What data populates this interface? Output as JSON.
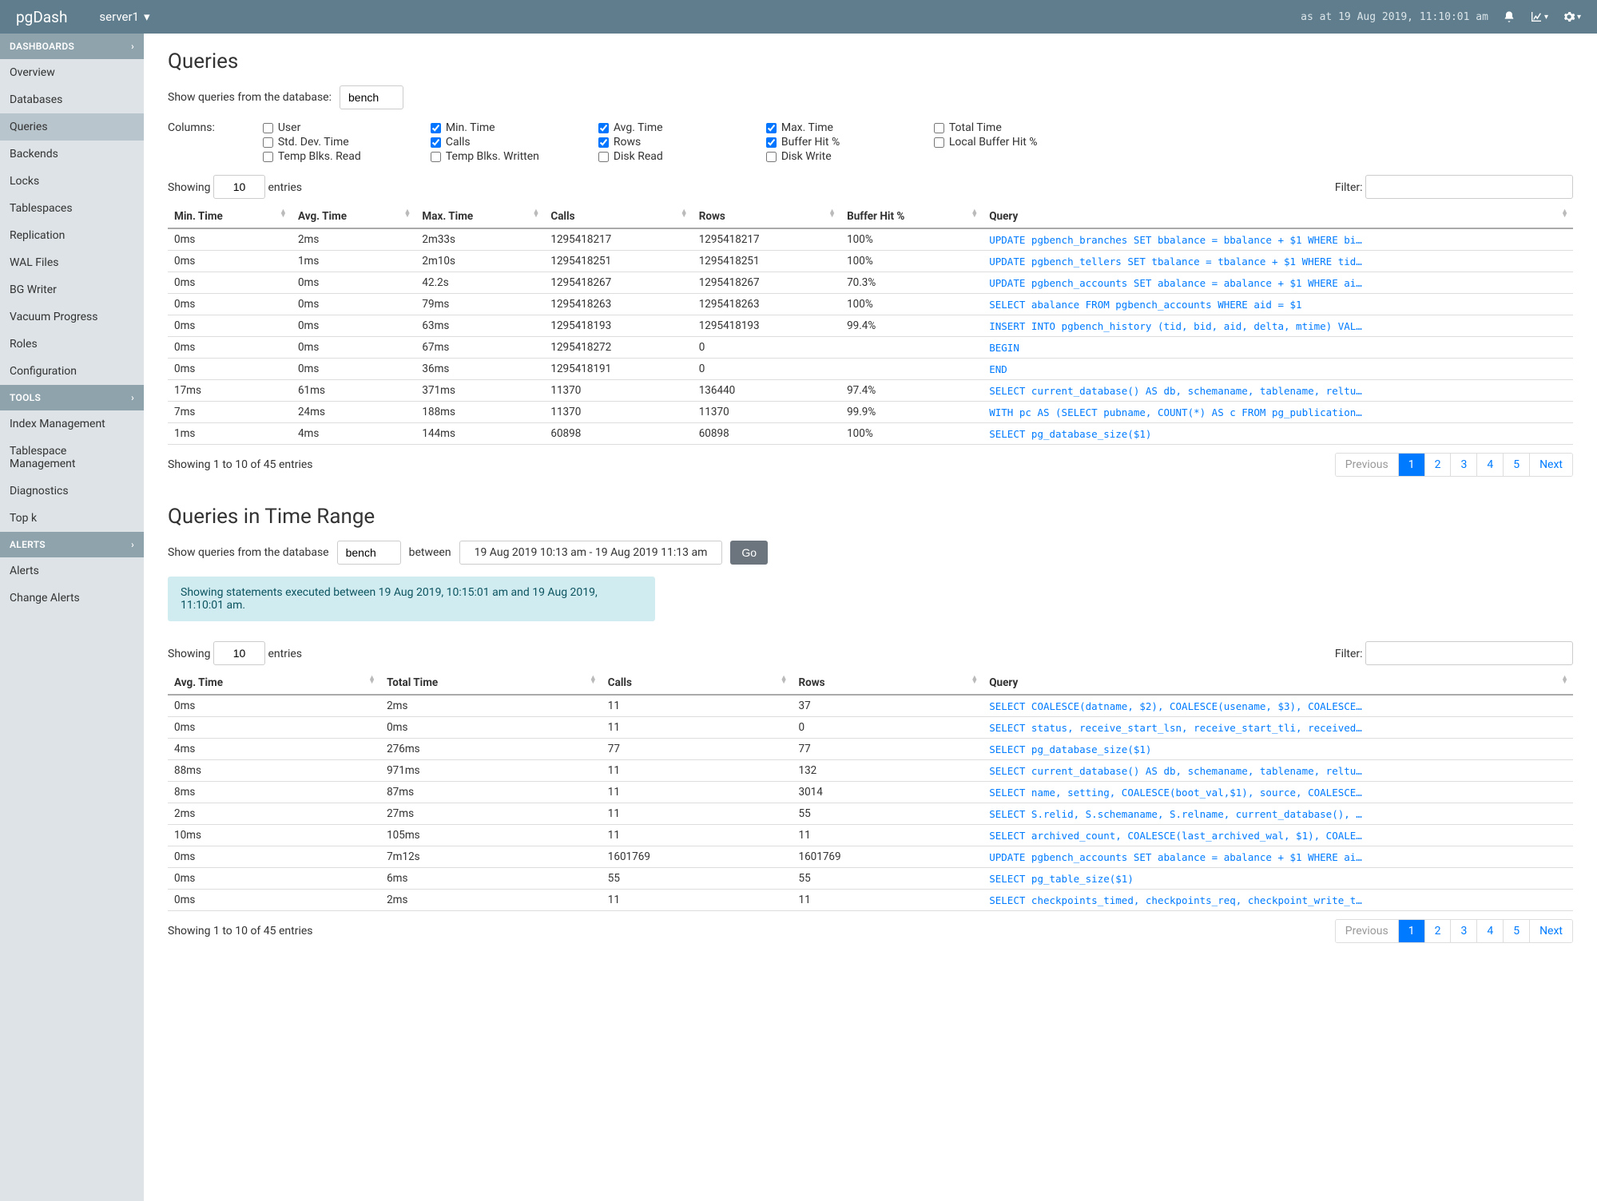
{
  "topbar": {
    "brand": "pgDash",
    "server": "server1",
    "timestamp": "as at 19 Aug 2019, 11:10:01 am"
  },
  "sidebar": {
    "sections": [
      {
        "title": "DASHBOARDS",
        "items": [
          "Overview",
          "Databases",
          "Queries",
          "Backends",
          "Locks",
          "Tablespaces",
          "Replication",
          "WAL Files",
          "BG Writer",
          "Vacuum Progress",
          "Roles",
          "Configuration"
        ],
        "active": "Queries"
      },
      {
        "title": "TOOLS",
        "items": [
          "Index Management",
          "Tablespace Management",
          "Diagnostics",
          "Top k"
        ]
      },
      {
        "title": "ALERTS",
        "items": [
          "Alerts",
          "Change Alerts"
        ]
      }
    ]
  },
  "queries": {
    "title": "Queries",
    "dbLabel": "Show queries from the database:",
    "dbValue": "bench",
    "columnsLabel": "Columns:",
    "columnOptions": [
      {
        "name": "User",
        "checked": false
      },
      {
        "name": "Min. Time",
        "checked": true
      },
      {
        "name": "Avg. Time",
        "checked": true
      },
      {
        "name": "Max. Time",
        "checked": true
      },
      {
        "name": "Total Time",
        "checked": false
      },
      {
        "name": "Std. Dev. Time",
        "checked": false
      },
      {
        "name": "Calls",
        "checked": true
      },
      {
        "name": "Rows",
        "checked": true
      },
      {
        "name": "Buffer Hit %",
        "checked": true
      },
      {
        "name": "Local Buffer Hit %",
        "checked": false
      },
      {
        "name": "Temp Blks. Read",
        "checked": false
      },
      {
        "name": "Temp Blks. Written",
        "checked": false
      },
      {
        "name": "Disk Read",
        "checked": false
      },
      {
        "name": "Disk Write",
        "checked": false
      }
    ],
    "showing_prefix": "Showing",
    "showing_entries": "entries",
    "showing_value": "10",
    "filter_label": "Filter:",
    "headers": [
      "Min. Time",
      "Avg. Time",
      "Max. Time",
      "Calls",
      "Rows",
      "Buffer Hit %",
      "Query"
    ],
    "rows": [
      {
        "min": "0ms",
        "avg": "2ms",
        "max": "2m33s",
        "calls": "1295418217",
        "rows": "1295418217",
        "hit": "100%",
        "query": "UPDATE pgbench_branches SET bbalance = bbalance + $1 WHERE bi…"
      },
      {
        "min": "0ms",
        "avg": "1ms",
        "max": "2m10s",
        "calls": "1295418251",
        "rows": "1295418251",
        "hit": "100%",
        "query": "UPDATE pgbench_tellers SET tbalance = tbalance + $1 WHERE tid…"
      },
      {
        "min": "0ms",
        "avg": "0ms",
        "max": "42.2s",
        "calls": "1295418267",
        "rows": "1295418267",
        "hit": "70.3%",
        "query": "UPDATE pgbench_accounts SET abalance = abalance + $1 WHERE ai…"
      },
      {
        "min": "0ms",
        "avg": "0ms",
        "max": "79ms",
        "calls": "1295418263",
        "rows": "1295418263",
        "hit": "100%",
        "query": "SELECT abalance FROM pgbench_accounts WHERE aid = $1"
      },
      {
        "min": "0ms",
        "avg": "0ms",
        "max": "63ms",
        "calls": "1295418193",
        "rows": "1295418193",
        "hit": "99.4%",
        "query": "INSERT INTO pgbench_history (tid, bid, aid, delta, mtime) VAL…"
      },
      {
        "min": "0ms",
        "avg": "0ms",
        "max": "67ms",
        "calls": "1295418272",
        "rows": "0",
        "hit": "",
        "query": "BEGIN"
      },
      {
        "min": "0ms",
        "avg": "0ms",
        "max": "36ms",
        "calls": "1295418191",
        "rows": "0",
        "hit": "",
        "query": "END"
      },
      {
        "min": "17ms",
        "avg": "61ms",
        "max": "371ms",
        "calls": "11370",
        "rows": "136440",
        "hit": "97.4%",
        "query": "SELECT current_database() AS db, schemaname, tablename, reltu…"
      },
      {
        "min": "7ms",
        "avg": "24ms",
        "max": "188ms",
        "calls": "11370",
        "rows": "11370",
        "hit": "99.9%",
        "query": "WITH pc AS (SELECT pubname, COUNT(*) AS c FROM pg_publication…"
      },
      {
        "min": "1ms",
        "avg": "4ms",
        "max": "144ms",
        "calls": "60898",
        "rows": "60898",
        "hit": "100%",
        "query": "SELECT pg_database_size($1)"
      }
    ],
    "result_info": "Showing 1 to 10 of 45 entries",
    "pages": [
      "Previous",
      "1",
      "2",
      "3",
      "4",
      "5",
      "Next"
    ],
    "active_page": "1"
  },
  "timerange": {
    "title": "Queries in Time Range",
    "dbLabel": "Show queries from the database",
    "dbValue": "bench",
    "betweenLabel": "between",
    "rangeValue": "19 Aug 2019 10:13 am - 19 Aug 2019 11:13 am",
    "goLabel": "Go",
    "alert": "Showing statements executed between 19 Aug 2019, 10:15:01 am and 19 Aug 2019, 11:10:01 am.",
    "showing_prefix": "Showing",
    "showing_entries": "entries",
    "showing_value": "10",
    "filter_label": "Filter:",
    "headers": [
      "Avg. Time",
      "Total Time",
      "Calls",
      "Rows",
      "Query"
    ],
    "rows": [
      {
        "avg": "0ms",
        "total": "2ms",
        "calls": "11",
        "rows": "37",
        "query": "SELECT COALESCE(datname, $2), COALESCE(usename, $3), COALESCE…"
      },
      {
        "avg": "0ms",
        "total": "0ms",
        "calls": "11",
        "rows": "0",
        "query": "SELECT status, receive_start_lsn, receive_start_tli, received…"
      },
      {
        "avg": "4ms",
        "total": "276ms",
        "calls": "77",
        "rows": "77",
        "query": "SELECT pg_database_size($1)"
      },
      {
        "avg": "88ms",
        "total": "971ms",
        "calls": "11",
        "rows": "132",
        "query": "SELECT current_database() AS db, schemaname, tablename, reltu…"
      },
      {
        "avg": "8ms",
        "total": "87ms",
        "calls": "11",
        "rows": "3014",
        "query": "SELECT name, setting, COALESCE(boot_val,$1), source, COALESCE…"
      },
      {
        "avg": "2ms",
        "total": "27ms",
        "calls": "11",
        "rows": "55",
        "query": "SELECT S.relid, S.schemaname, S.relname, current_database(), …"
      },
      {
        "avg": "10ms",
        "total": "105ms",
        "calls": "11",
        "rows": "11",
        "query": "SELECT archived_count, COALESCE(last_archived_wal, $1), COALE…"
      },
      {
        "avg": "0ms",
        "total": "7m12s",
        "calls": "1601769",
        "rows": "1601769",
        "query": "UPDATE pgbench_accounts SET abalance = abalance + $1 WHERE ai…"
      },
      {
        "avg": "0ms",
        "total": "6ms",
        "calls": "55",
        "rows": "55",
        "query": "SELECT pg_table_size($1)"
      },
      {
        "avg": "0ms",
        "total": "2ms",
        "calls": "11",
        "rows": "11",
        "query": "SELECT checkpoints_timed, checkpoints_req, checkpoint_write_t…"
      }
    ],
    "result_info": "Showing 1 to 10 of 45 entries",
    "pages": [
      "Previous",
      "1",
      "2",
      "3",
      "4",
      "5",
      "Next"
    ],
    "active_page": "1"
  }
}
